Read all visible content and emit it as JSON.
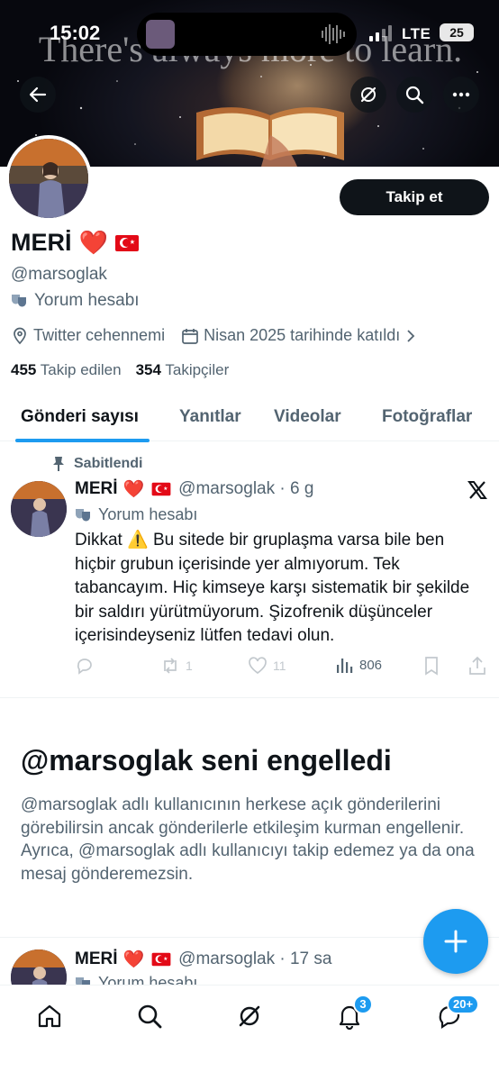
{
  "status_bar": {
    "time": "15:02",
    "network": "LTE",
    "battery": "25"
  },
  "banner": {
    "caption": "There's always more to learn."
  },
  "profile": {
    "display_name": "MERİ",
    "name_emoji": "❤️",
    "handle": "@marsoglak",
    "bio": "Yorum hesabı",
    "location": "Twitter cehennemi",
    "joined": "Nisan 2025 tarihinde katıldı",
    "following_count": "455",
    "following_label": "Takip edilen",
    "followers_count": "354",
    "followers_label": "Takipçiler",
    "follow_button": "Takip et"
  },
  "tabs": [
    {
      "label": "Gönderi sayısı",
      "active": true
    },
    {
      "label": "Yanıtlar",
      "active": false
    },
    {
      "label": "Videolar",
      "active": false
    },
    {
      "label": "Fotoğraflar",
      "active": false
    }
  ],
  "pinned_tweet": {
    "pinned_label": "Sabitlendi",
    "name": "MERİ",
    "name_emoji": "❤️",
    "handle_time": "@marsoglak · 6 g",
    "sub": "Yorum hesabı",
    "text": "Dikkat ⚠️ Bu sitede bir gruplaşma varsa bile ben hiçbir grubun içerisinde yer almıyorum. Tek tabancayım. Hiç kimseye karşı sistematik bir şekilde bir saldırı yürütmüyorum. Şizofrenik düşünceler içerisindeyseniz lütfen tedavi olun.",
    "retweets": "1",
    "likes": "11",
    "views": "806"
  },
  "blocked": {
    "title": "@marsoglak seni engelledi",
    "text": "@marsoglak adlı kullanıcının herkese açık gönderilerini görebilirsin ancak gönderilerle etkileşim kurman engellenir. Ayrıca, @marsoglak adlı kullanıcıyı takip edemez ya da ona mesaj gönderemezsin."
  },
  "second_tweet": {
    "name": "MERİ",
    "name_emoji": "❤️",
    "handle_time": "@marsoglak · 17 sa",
    "sub": "Yorum hesabı"
  },
  "bottom_nav": {
    "notifications_badge": "3",
    "messages_badge": "20+"
  },
  "colors": {
    "accent": "#1d9bf0",
    "text": "#0f1419",
    "muted": "#536471"
  }
}
